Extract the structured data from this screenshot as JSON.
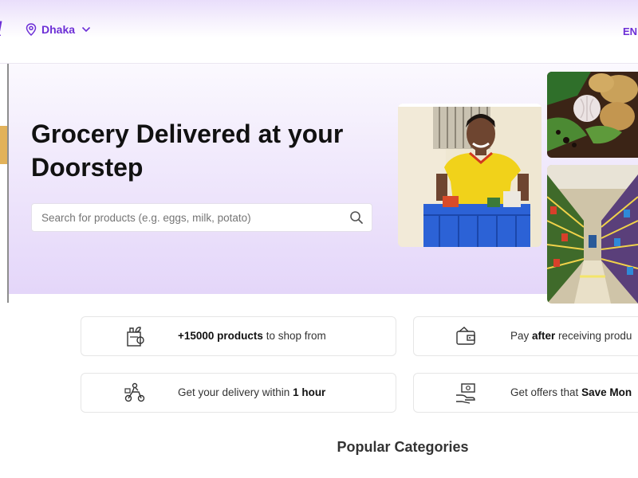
{
  "header": {
    "logo_fragment": "l",
    "location": {
      "city": "Dhaka"
    },
    "language": "EN"
  },
  "hero": {
    "title": "Grocery Delivered at your Doorstep",
    "search": {
      "placeholder": "Search for products (e.g. eggs, milk, potato)"
    }
  },
  "features": [
    {
      "icon": "grocery-bag-icon",
      "bold": "+15000 products",
      "rest": " to shop from"
    },
    {
      "icon": "wallet-icon",
      "pre": "Pay ",
      "bold": "after",
      "rest": " receiving produ"
    },
    {
      "icon": "delivery-scooter-icon",
      "pre": "Get your delivery within ",
      "bold": "1 hour"
    },
    {
      "icon": "money-hand-icon",
      "pre": "Get offers that ",
      "bold": "Save Mon"
    }
  ],
  "sections": {
    "popular_title": "Popular Categories"
  },
  "colors": {
    "brand": "#6d2fd6",
    "hero_bg": "#e4d6f9",
    "accent_tab": "#e2b25a"
  }
}
